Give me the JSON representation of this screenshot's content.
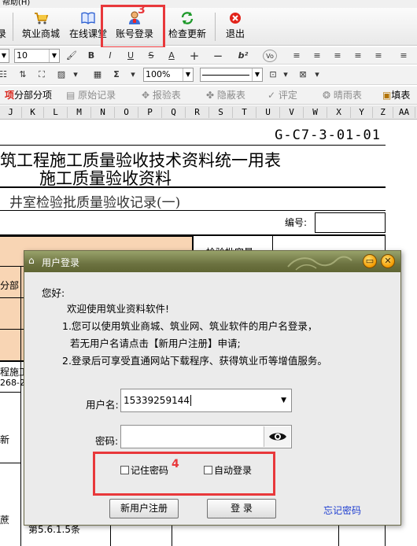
{
  "menu": {
    "help_label": "帮助(H)"
  },
  "toolbar": {
    "partial_label": "录",
    "mall_label": "筑业商城",
    "classroom_label": "在线课堂",
    "account_label": "账号登录",
    "update_label": "检查更新",
    "exit_label": "退出"
  },
  "format_bar": {
    "font_size": "10",
    "bold": "B",
    "italic": "I",
    "underline": "U",
    "strike": "S",
    "font_color": "A",
    "superscript": "b²",
    "zoom": "100%",
    "sigma": "Σ"
  },
  "commands": {
    "subitem": "分部分项",
    "original_record": "原始记录",
    "inspection_report": "报验表",
    "hidden_report": "隐蔽表",
    "evaluate": "评定",
    "weather": "晴雨表",
    "fill": "填表"
  },
  "columns": [
    "J",
    "K",
    "L",
    "M",
    "N",
    "O",
    "P",
    "Q",
    "R",
    "S",
    "T",
    "U",
    "V",
    "W",
    "X",
    "Y",
    "Z",
    "AA"
  ],
  "sheet": {
    "code": "G-C7-3-01-01",
    "title_line1": "筑工程施工质量验收技术资料统一用表",
    "title_line2": "施工质量验收资料",
    "subtitle": "井室检验批质量验收记录(一)",
    "number_label": "编号:",
    "batch_label": "检验批容量",
    "left_fragment_1": "分部",
    "left_fragment_2": "程施工",
    "left_fragment_3": "268-2",
    "left_fragment_4": "新",
    "left_fragment_5": "蔗",
    "bottom_fragment": "第5.6.1.5条"
  },
  "dialog": {
    "title": "用户登录",
    "greeting": "您好:",
    "welcome": "欢迎使用筑业资料软件!",
    "line1": "1.您可以使用筑业商城、筑业网、筑业软件的用户名登录，",
    "line1b": "若无用户名请点击【新用户注册】申请;",
    "line2": "2.登录后可享受直通网站下载程序、获得筑业币等增值服务。",
    "username_label": "用户名:",
    "username_value": "15339259144",
    "password_label": "密码:",
    "password_value": "",
    "remember_label": "记住密码",
    "autologin_label": "自动登录",
    "register_label": "新用户注册",
    "login_label": "登  录",
    "forgot_label": "忘记密码"
  },
  "annotations": {
    "step3": "3",
    "step4": "4"
  },
  "colors": {
    "annotation_red": "#e8383b",
    "dialog_title": "#6d7341",
    "link_blue": "#1f3fd1",
    "peach": "#f8d5b4"
  }
}
